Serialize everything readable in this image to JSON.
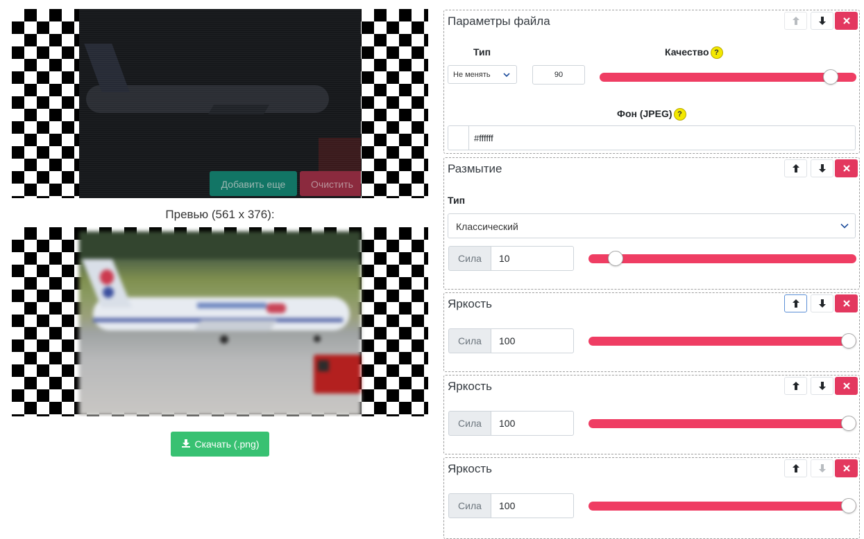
{
  "source_image": {
    "buttons": {
      "add_more": "Добавить еще",
      "clear": "Очистить"
    }
  },
  "preview": {
    "label": "Превью (561 x 376):",
    "download_label": "Скачать (.png)"
  },
  "panels": [
    {
      "title": "Параметры файла",
      "type_label": "Тип",
      "type_value": "Не менять",
      "quality_label": "Качество",
      "quality_value": "90",
      "quality_slider": 0.9,
      "bg_label": "Фон (JPEG)",
      "bg_value": "#ffffff",
      "help_glyph": "?",
      "up_enabled": false,
      "down_enabled": true
    },
    {
      "title": "Размытие",
      "type_label": "Тип",
      "type_value": "Классический",
      "strength_label": "Сила",
      "strength_value": "10",
      "strength_slider": 0.1,
      "up_enabled": true,
      "down_enabled": true
    },
    {
      "title": "Яркость",
      "strength_label": "Сила",
      "strength_value": "100",
      "strength_slider": 1.0,
      "up_enabled": true,
      "down_enabled": true
    },
    {
      "title": "Яркость",
      "strength_label": "Сила",
      "strength_value": "100",
      "strength_slider": 1.0,
      "up_enabled": true,
      "down_enabled": true
    },
    {
      "title": "Яркость",
      "strength_label": "Сила",
      "strength_value": "100",
      "strength_slider": 1.0,
      "up_enabled": true,
      "down_enabled": false
    }
  ],
  "colors": {
    "accent_slider": "#ef3d63",
    "delete_button": "#e3385f",
    "download_button": "#38c172",
    "help_badge": "#f3e800"
  },
  "icons": {
    "up": "arrow-up-icon",
    "down": "arrow-down-icon",
    "delete": "close-icon",
    "download": "download-icon",
    "select": "chevron-down-icon"
  }
}
